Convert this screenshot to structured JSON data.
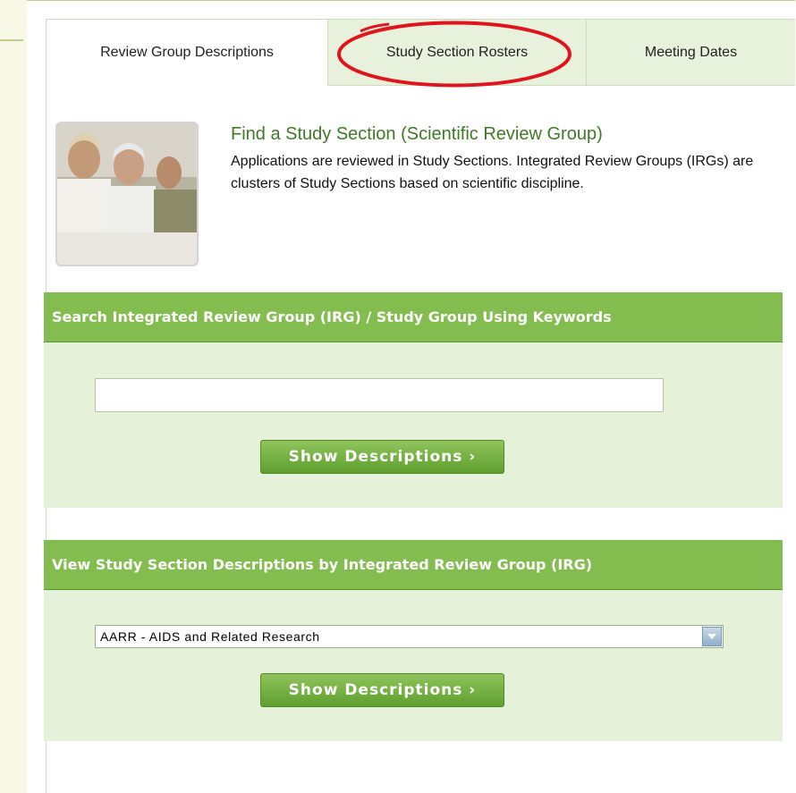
{
  "tabs": [
    {
      "label": "Review Group Descriptions",
      "active": true
    },
    {
      "label": "Study Section Rosters",
      "active": false,
      "highlighted": true
    },
    {
      "label": "Meeting Dates",
      "active": false
    }
  ],
  "intro": {
    "title": "Find a Study Section (Scientific Review Group)",
    "text": "Applications are reviewed in Study Sections. Integrated Review Groups (IRGs) are clusters of Study Sections based on scientific discipline."
  },
  "keyword_search": {
    "heading": "Search Integrated Review Group (IRG) / Study Group Using Keywords",
    "input_value": "",
    "button_label": "Show Descriptions ›"
  },
  "irg_browse": {
    "heading": "View Study Section Descriptions by Integrated Review Group (IRG)",
    "selected_option": "AARR - AIDS and Related Research",
    "button_label": "Show Descriptions ›"
  },
  "colors": {
    "section_header": "#84bd4f",
    "section_body": "#e6f1da",
    "tab_inactive": "#e8f1dc",
    "title_green": "#3e7a26",
    "highlight_circle": "#e0141c"
  }
}
